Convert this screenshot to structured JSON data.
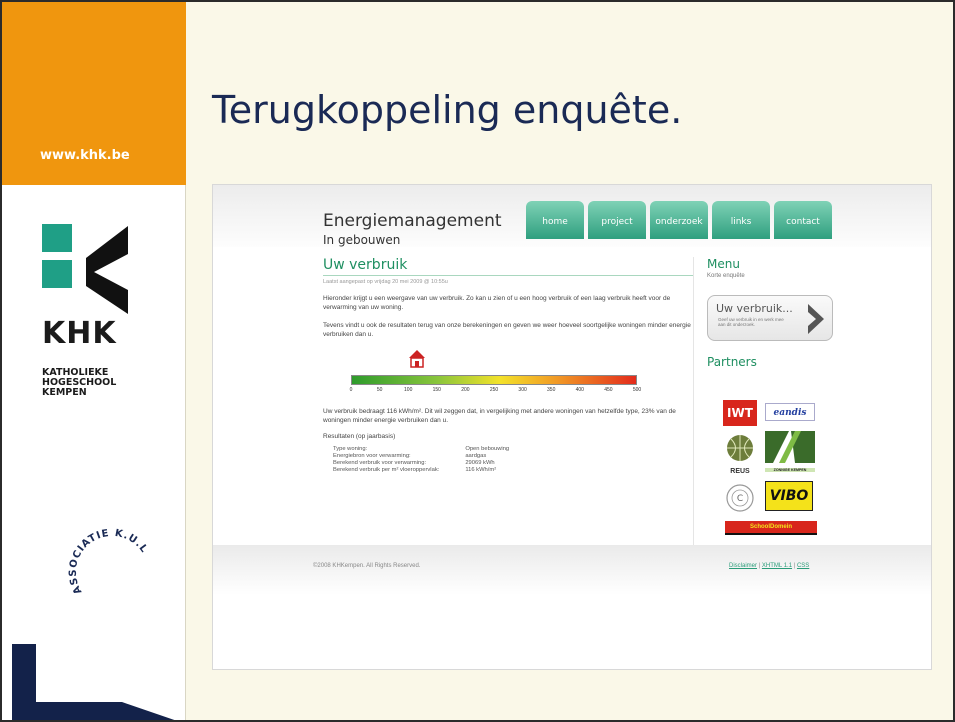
{
  "sidebar": {
    "site_url": "www.khk.be",
    "logo_text": "KHK",
    "logo_subtitle_lines": [
      "KATHOLIEKE",
      "HOGESCHOOL",
      "KEMPEN"
    ],
    "seal_text": "ASSOCIATIE K.U.LEUVEN"
  },
  "slide": {
    "title": "Terugkoppeling enquête."
  },
  "web": {
    "brand_title": "Energiemanagement",
    "brand_subtitle": "In gebouwen",
    "nav": [
      "home",
      "project",
      "onderzoek",
      "links",
      "contact"
    ],
    "section_title": "Uw verbruik",
    "last_modified": "Laatst aangepast op vrijdag 20 mei 2009 @ 10:55u",
    "para1": "Hieronder krijgt u een weergave van uw verbruik. Zo kan u zien of u een hoog verbruik of een laag verbruik heeft voor de verwarming van uw woning.",
    "para2": "Tevens vindt u ook de resultaten terug van onze berekeningen en geven we weer hoeveel soortgelijke woningen minder energie verbruiken dan u.",
    "meter": {
      "ticks": [
        "0",
        "50",
        "100",
        "150",
        "200",
        "250",
        "300",
        "350",
        "400",
        "450",
        "500"
      ],
      "value": 116,
      "max": 500
    },
    "result_sentence": "Uw verbruik bedraagt 116 kWh/m². Dit wil zeggen dat, in vergelijking met andere woningen van hetzelfde type, 23% van de woningen minder energie verbruiken dan u.",
    "results_header": "Resultaten (op jaarbasis)",
    "results": [
      {
        "label": "Type woning:",
        "value": "Open bebouwing"
      },
      {
        "label": "Energiebron voor verwarming:",
        "value": "aardgas"
      },
      {
        "label": "Berekend verbruik voor verwarming:",
        "value": "29069 kWh"
      },
      {
        "label": "Berekend verbruik per m² vloeroppervlak:",
        "value": "116 kWh/m²"
      }
    ],
    "menu_title": "Menu",
    "menu_item": "Korte enquête",
    "uv_button_title": "Uw verbruik...",
    "uv_button_desc": "Geef uw verbruik in en werk mee aan dit onderzoek.",
    "partners_title": "Partners",
    "partners": [
      "IWT",
      "eandis",
      "REUS",
      "ZONNIGE KEMPEN",
      "VIBO",
      "VIBO",
      "SchoolDomein"
    ],
    "footer_copyright": "©2008 KHKempen. All Rights Reserved.",
    "footer_links": [
      "Disclaimer",
      "XHTML 1.1",
      "CSS"
    ]
  },
  "colors": {
    "orange": "#f0960e",
    "navy": "#1a2a55",
    "teal": "#2a9c79",
    "green_heading": "#1f8f61"
  }
}
